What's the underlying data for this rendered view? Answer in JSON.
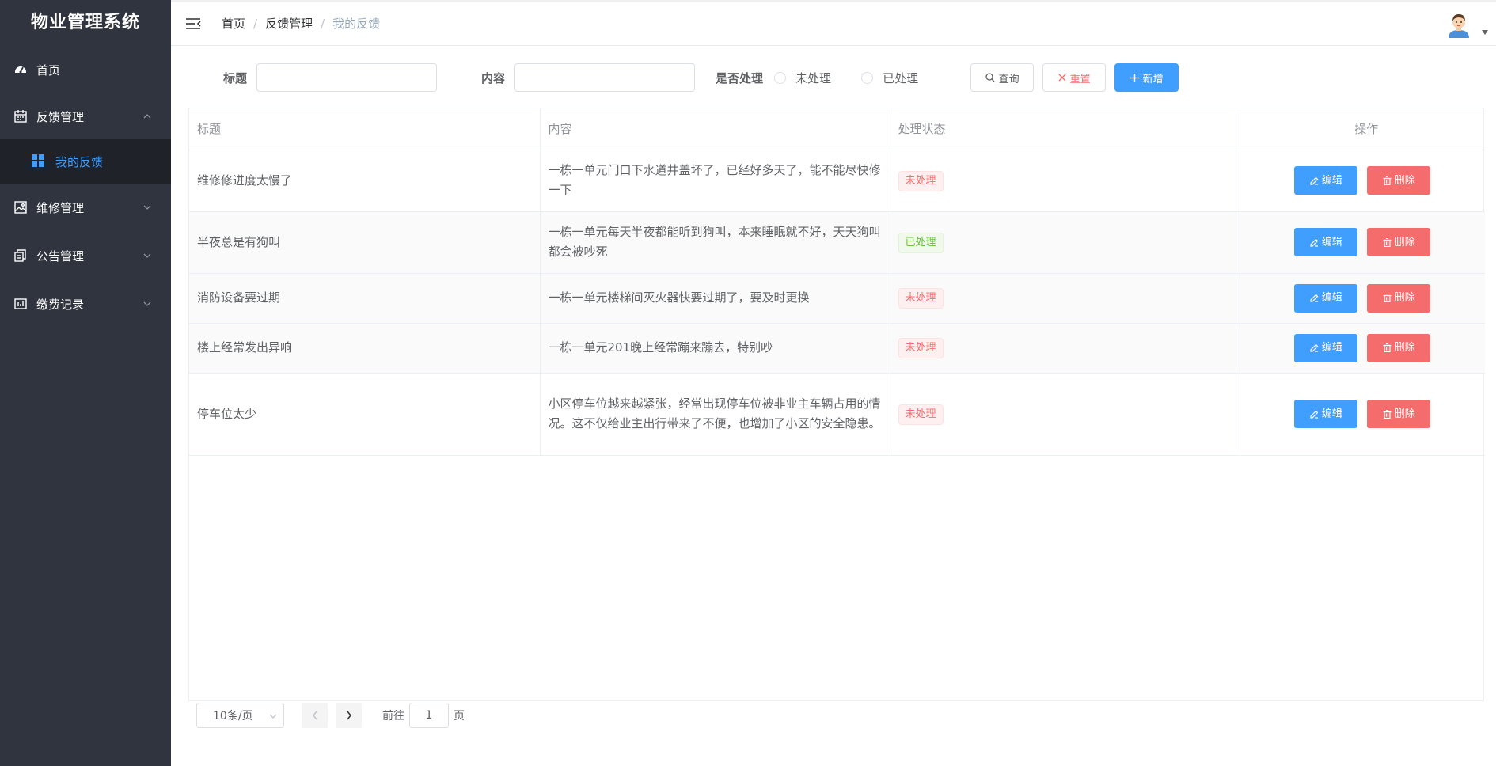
{
  "app": {
    "title": "物业管理系统"
  },
  "sidebar": {
    "items": [
      {
        "label": "首页",
        "icon": "dashboard-icon"
      },
      {
        "label": "反馈管理",
        "icon": "calendar-icon",
        "expanded": true,
        "children": [
          {
            "label": "我的反馈",
            "icon": "grid-icon",
            "active": true
          }
        ]
      },
      {
        "label": "维修管理",
        "icon": "picture-icon"
      },
      {
        "label": "公告管理",
        "icon": "copy-icon"
      },
      {
        "label": "缴费记录",
        "icon": "data-board-icon"
      }
    ]
  },
  "header": {
    "breadcrumb": [
      "首页",
      "反馈管理",
      "我的反馈"
    ],
    "separator": "/"
  },
  "filters": {
    "title_label": "标题",
    "content_label": "内容",
    "status_label": "是否处理",
    "status_options": [
      "未处理",
      "已处理"
    ],
    "query_label": "查询",
    "reset_label": "重置",
    "add_label": "新增"
  },
  "table": {
    "columns": [
      "标题",
      "内容",
      "处理状态",
      "操作"
    ],
    "edit_label": "编辑",
    "delete_label": "删除",
    "rows": [
      {
        "title": "维修修进度太慢了",
        "content": "一栋一单元门口下水道井盖坏了，已经好多天了，能不能尽快修一下",
        "status": "未处理"
      },
      {
        "title": "半夜总是有狗叫",
        "content": "一栋一单元每天半夜都能听到狗叫，本来睡眠就不好，天天狗叫都会被吵死",
        "status": "已处理"
      },
      {
        "title": "消防设备要过期",
        "content": "一栋一单元楼梯间灭火器快要过期了，要及时更换",
        "status": "未处理"
      },
      {
        "title": "楼上经常发出异响",
        "content": "一栋一单元201晚上经常蹦来蹦去，特别吵",
        "status": "未处理"
      },
      {
        "title": "停车位太少",
        "content": "小区停车位越来越紧张，经常出现停车位被非业主车辆占用的情况。这不仅给业主出行带来了不便，也增加了小区的安全隐患。",
        "status": "未处理"
      }
    ]
  },
  "pagination": {
    "page_size": "10条/页",
    "goto_label": "前往",
    "page_value": "1",
    "page_suffix": "页"
  },
  "colors": {
    "sidebar_bg": "#30343e",
    "active_submenu_bg": "#1f2229",
    "primary": "#409eff",
    "danger": "#f56c6c",
    "success": "#67c23a"
  }
}
